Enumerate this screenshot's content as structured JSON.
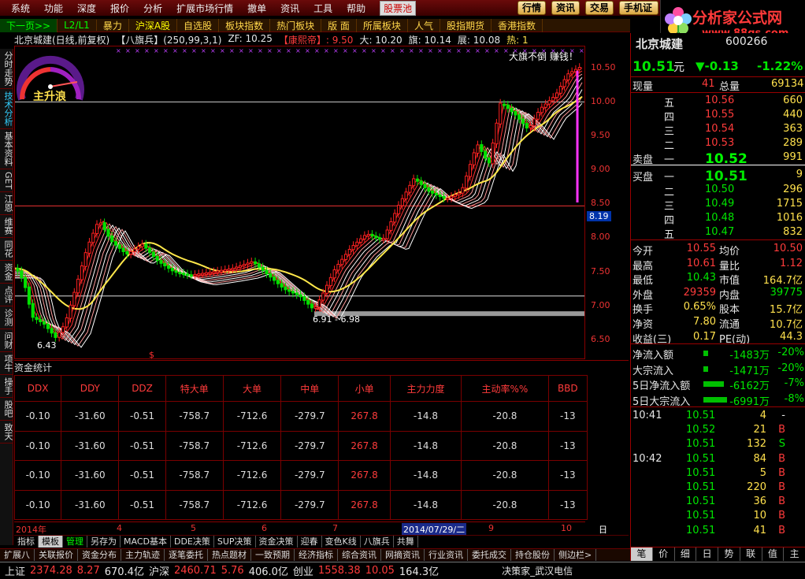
{
  "menu": {
    "items": [
      "系统",
      "功能",
      "深度",
      "报价",
      "分析",
      "扩展市场行情",
      "撤单",
      "资讯",
      "工具",
      "帮助"
    ],
    "highlight": "股票池",
    "right_buttons": [
      "行情",
      "资讯",
      "交易",
      "手机证"
    ]
  },
  "logo": {
    "title": "分析家公式网",
    "url": "www.88gs.com"
  },
  "tabs": [
    "下一页>>",
    "L2/L1",
    "暴力",
    "沪深A股",
    "自选股",
    "板块指数",
    "热门板块",
    "版 面",
    "所属板块",
    "人气",
    "股指期货",
    "香港指数"
  ],
  "left_tabs": [
    "分时走势",
    "技术分析",
    "基本资料",
    "GET",
    "江恩",
    "维赛",
    "同花",
    "资金",
    "点评",
    "诊测",
    "问财",
    "项牛",
    "操手",
    "股吧",
    "致天"
  ],
  "chart": {
    "stock_title": "北京城建(日线,前复权)",
    "indicator": "【八旗兵】(250,99,3,1)",
    "zf": "ZF: 10.25",
    "kangxi": "【康熙帝】: 9.50",
    "da": "大: 10.20",
    "qi": "旗: 10.14",
    "zhan": "展: 10.08",
    "re": "热: 1",
    "gauge_label": "主升浪",
    "annotation_top": "大旗不倒 赚钱！",
    "range_label": "6.91 - 6.98",
    "low_label": "6.43",
    "price_tag": "8.19",
    "s_mark": "$"
  },
  "chart_data": {
    "type": "candlestick",
    "y_ticks": [
      "10.50",
      "10.00",
      "9.50",
      "9.00",
      "8.50",
      "8.00",
      "7.50",
      "7.00",
      "6.50"
    ],
    "ylim": [
      6.3,
      10.8
    ],
    "x_ticks": [
      "2014年",
      "4",
      "5",
      "6",
      "7",
      "2014/07/29/二",
      "9",
      "10"
    ],
    "x_label_right": "日线"
  },
  "dde": {
    "section_title": "资金统计",
    "headers": [
      "DDX",
      "DDY",
      "DDZ",
      "特大单",
      "大单",
      "中单",
      "小单",
      "主力力度",
      "主动率%%",
      "BBD"
    ],
    "rows": [
      [
        "-0.10",
        "-31.60",
        "-0.51",
        "-758.7",
        "-712.6",
        "-279.7",
        "267.8",
        "-14.8",
        "-20.8",
        "-13"
      ],
      [
        "-0.10",
        "-31.60",
        "-0.51",
        "-758.7",
        "-712.6",
        "-279.7",
        "267.8",
        "-14.8",
        "-20.8",
        "-13"
      ],
      [
        "-0.10",
        "-31.60",
        "-0.51",
        "-758.7",
        "-712.6",
        "-279.7",
        "267.8",
        "-14.8",
        "-20.8",
        "-13"
      ],
      [
        "-0.10",
        "-31.60",
        "-0.51",
        "-758.7",
        "-712.6",
        "-279.7",
        "267.8",
        "-14.8",
        "-20.8",
        "-13"
      ]
    ]
  },
  "ind_bar": [
    "指标",
    "模板",
    "管理",
    "另存为",
    "MACD基本",
    "DDE决策",
    "SUP决策",
    "资金决策",
    "迎春",
    "变色K线",
    "八旗兵",
    "共舞"
  ],
  "func_bar": [
    "扩展八",
    "关联报价",
    "资金分布",
    "主力轨迹",
    "逐笔委托",
    "热点题材",
    "一致预期",
    "经济指标",
    "综合资讯",
    "网摘资讯",
    "行业资讯",
    "委托成交",
    "持仓股份",
    "侧边栏>"
  ],
  "status": {
    "sh_name": "上证",
    "sh_val": "2374.28",
    "sh_chg": "8.27",
    "sh_amt": "670.4亿",
    "hs_name": "沪深",
    "hs_val": "2460.71",
    "hs_chg": "5.76",
    "hs_amt": "406.0亿",
    "cy_name": "创业",
    "cy_val": "1558.38",
    "cy_chg": "10.05",
    "cy_amt": "164.3亿",
    "broker": "决策家_武汉电信"
  },
  "quote": {
    "name": "北京城建",
    "code": "600266",
    "price": "10.51",
    "unit": "元",
    "change": "▼-0.13",
    "pct": "-1.22%",
    "xianliang_label": "现量",
    "xianliang": "41",
    "zongliang_label": "总量",
    "zongliang": "69134",
    "sells": [
      {
        "l": "五",
        "p": "10.56",
        "v": "660"
      },
      {
        "l": "四",
        "p": "10.55",
        "v": "440"
      },
      {
        "l": "三",
        "p": "10.54",
        "v": "363"
      },
      {
        "l": "二",
        "p": "10.53",
        "v": "289"
      },
      {
        "l": "一",
        "p": "10.52",
        "v": "991"
      }
    ],
    "sell_label": "卖盘",
    "buy_label": "买盘",
    "buys": [
      {
        "l": "一",
        "p": "10.51",
        "v": "9"
      },
      {
        "l": "二",
        "p": "10.50",
        "v": "296"
      },
      {
        "l": "三",
        "p": "10.49",
        "v": "1715"
      },
      {
        "l": "四",
        "p": "10.48",
        "v": "1016"
      },
      {
        "l": "五",
        "p": "10.47",
        "v": "832"
      }
    ],
    "stats": [
      {
        "a": "今开",
        "av": "10.55",
        "b": "均价",
        "bv": "10.50"
      },
      {
        "a": "最高",
        "av": "10.61",
        "b": "量比",
        "bv": "1.12"
      },
      {
        "a": "最低",
        "av": "10.43",
        "b": "市值",
        "bv": "164.7亿"
      },
      {
        "a": "外盘",
        "av": "29359",
        "b": "内盘",
        "bv": "39775"
      },
      {
        "a": "换手",
        "av": "0.65%",
        "b": "股本",
        "bv": "15.7亿"
      },
      {
        "a": "净资",
        "av": "7.80",
        "b": "流通",
        "bv": "10.7亿"
      },
      {
        "a": "收益(三)",
        "av": "0.17",
        "b": "PE(动)",
        "bv": "44.3"
      }
    ],
    "flows": [
      {
        "l": "净流入额",
        "v": "-1483万",
        "p": "-20%"
      },
      {
        "l": "大宗流入",
        "v": "-1471万",
        "p": "-20%"
      },
      {
        "l": "5日净流入额",
        "v": "-6162万",
        "p": "-7%"
      },
      {
        "l": "5日大宗流入",
        "v": "-6991万",
        "p": "-8%"
      }
    ],
    "ticks": [
      {
        "t": "10:41",
        "p": "10.51",
        "v": "4",
        "d": "-"
      },
      {
        "t": "",
        "p": "10.52",
        "v": "21",
        "d": "B"
      },
      {
        "t": "",
        "p": "10.51",
        "v": "132",
        "d": "S"
      },
      {
        "t": "10:42",
        "p": "10.51",
        "v": "84",
        "d": "B"
      },
      {
        "t": "",
        "p": "10.51",
        "v": "5",
        "d": "B"
      },
      {
        "t": "",
        "p": "10.51",
        "v": "220",
        "d": "B"
      },
      {
        "t": "",
        "p": "10.51",
        "v": "36",
        "d": "B"
      },
      {
        "t": "",
        "p": "10.51",
        "v": "10",
        "d": "B"
      },
      {
        "t": "",
        "p": "10.51",
        "v": "41",
        "d": "B"
      }
    ],
    "tabs": [
      "笔",
      "价",
      "细",
      "日",
      "势",
      "联",
      "值",
      "主"
    ]
  }
}
